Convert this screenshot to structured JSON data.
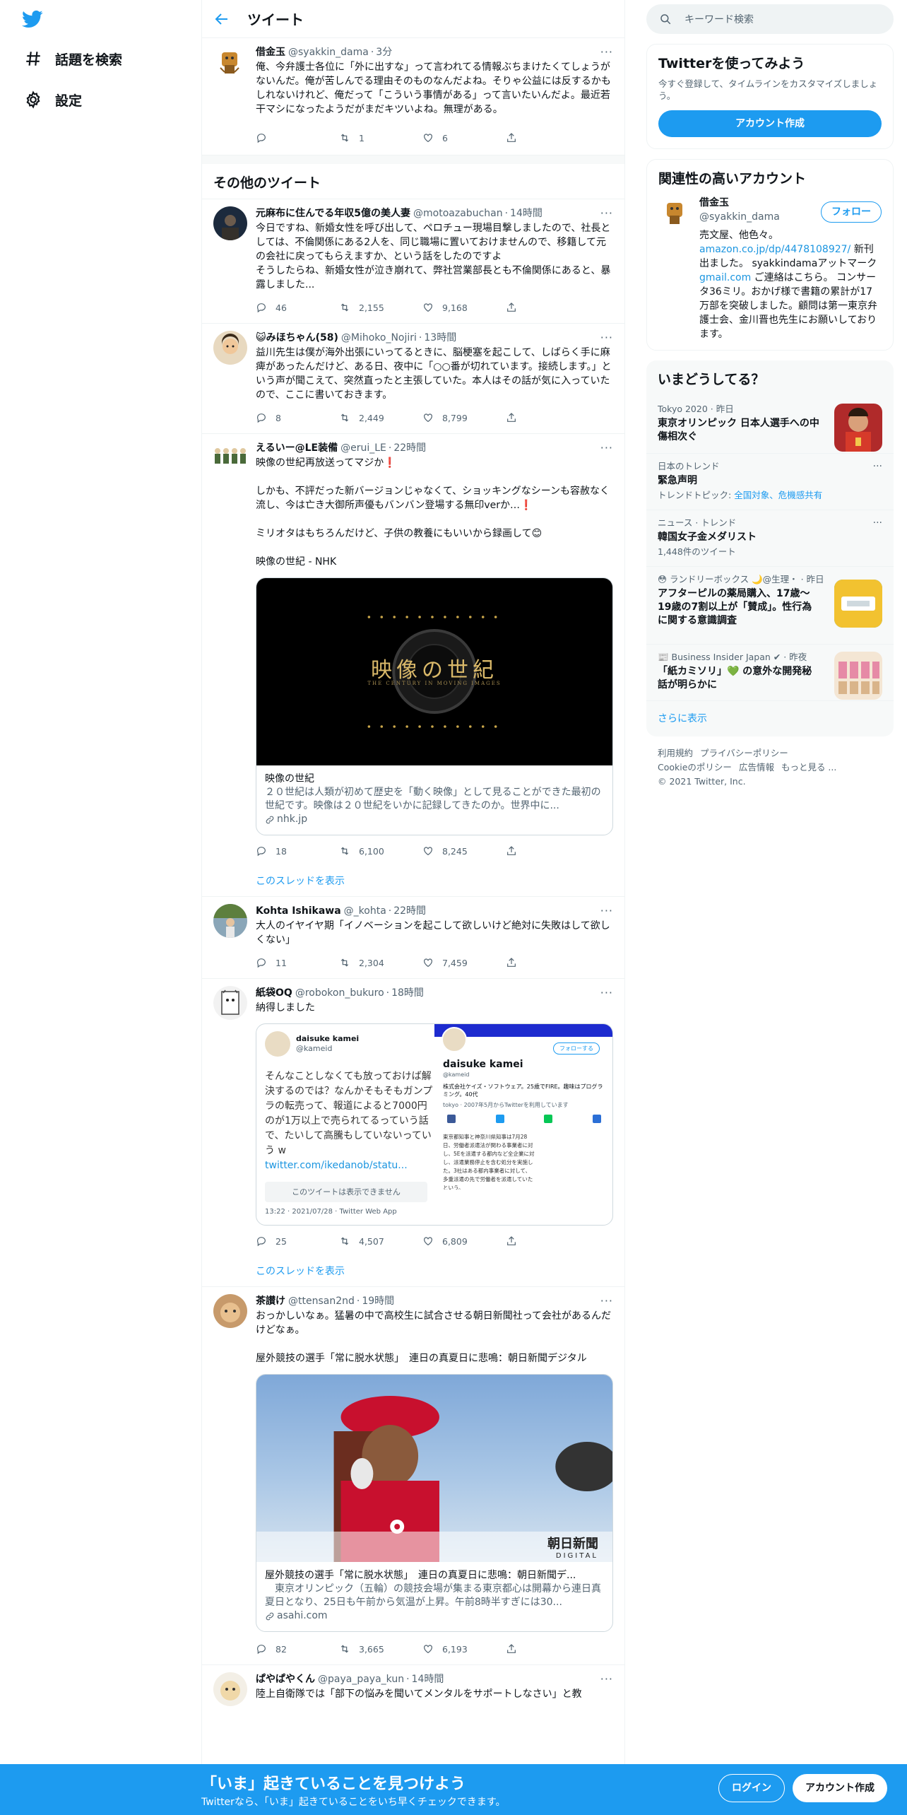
{
  "nav": {
    "explore": "話題を検索",
    "settings": "設定"
  },
  "header": {
    "title": "ツイート"
  },
  "main_tweet": {
    "name": "借金玉",
    "handle": "@syakkin_dama",
    "time": "3分",
    "text": "俺、今弁護士各位に「外に出すな」って言われてる情報ぶちまけたくてしょうがないんだ。俺が苦しんでる理由そのものなんだよね。そりゃ公益には反するかもしれないけれど、俺だって「こういう事情がある」って言いたいんだよ。最近若干マシになったようだがまだキツいよね。無理がある。",
    "reply": "",
    "retweet": "1",
    "like": "6"
  },
  "section_title": "その他のツイート",
  "tweets": [
    {
      "name": "元麻布に住んでる年収5億の美人妻",
      "handle": "@motoazabuchan",
      "time": "14時間",
      "text": "今日ですね、新婚女性を呼び出して、ペロチュー現場目撃しましたので、社長としては、不倫関係にある2人を、同じ職場に置いておけませんので、移籍して元の会社に戻ってもらえますか、という話をしたのですよ\nそうしたらね、新婚女性が泣き崩れて、弊社営業部長とも不倫関係にあると、暴露しました...",
      "reply": "46",
      "retweet": "2,155",
      "like": "9,168"
    },
    {
      "name": "😺みほちゃん(58)",
      "handle": "@Mihoko_Nojiri",
      "time": "13時間",
      "text": "益川先生は僕が海外出張にいってるときに、脳梗塞を起こして、しばらく手に麻痺があったんだけど、ある日、夜中に「○○番が切れています。接続します。」という声が聞こえて、突然直ったと主張していた。本人はその話が気に入っていたので、ここに書いておきます。",
      "reply": "8",
      "retweet": "2,449",
      "like": "8,799"
    },
    {
      "name": "えるいー@LE装備",
      "handle": "@erui_LE",
      "time": "22時間",
      "text": "映像の世紀再放送ってマジか❗\n\nしかも、不評だった新バージョンじゃなくて、ショッキングなシーンも容赦なく流し、今は亡き大御所声優もバンバン登場する無印verか…❗\n\nミリオタはもちろんだけど、子供の教養にもいいから録画して😊\n\n映像の世紀 - NHK",
      "card": {
        "logo_title": "映像の世紀",
        "logo_sub": "THE CENTURY IN MOVING IMAGES",
        "title": "映像の世紀",
        "desc": "２０世紀は人類が初めて歴史を「動く映像」として見ることができた最初の世紀です。映像は２０世紀をいかに記録してきたのか。世界中に...",
        "url": "nhk.jp"
      },
      "reply": "18",
      "retweet": "6,100",
      "like": "8,245",
      "thread": "このスレッドを表示"
    },
    {
      "name": "Kohta Ishikawa",
      "handle": "@_kohta",
      "time": "22時間",
      "text": "大人のイヤイヤ期「イノベーションを起こして欲しいけど絶対に失敗はして欲しくない」",
      "reply": "11",
      "retweet": "2,304",
      "like": "7,459"
    },
    {
      "name": "紙袋OQ",
      "handle": "@robokon_bukuro",
      "time": "18時間",
      "text": "納得しました",
      "quote": {
        "name": "daisuke kamei",
        "handle": "@kameid",
        "text": "そんなことしなくても放っておけば解決するのでは？なんかそもそもガンプラの転売って、報道によると7000円のが1万以上で売られてるっていう話で、たいして高騰もしていないってい う w ",
        "link": "twitter.com/ikedanob/statu...",
        "notice": "このツイートは表示できません",
        "footer": "13:22 · 2021/07/28 · Twitter Web App",
        "profile_name": "daisuke kamei",
        "profile_handle": "@kameid",
        "profile_follow": "フォローする",
        "profile_bio": "株式会社ケイズ・ソフトウェア。25歳でFIRE。趣味はプログラミング。40代",
        "profile_loc": "tokyo",
        "profile_joined": "2007年5月からTwitterを利用しています",
        "profile_article": "東京都知事と神奈川県知事は7月28日、労働者派遣法が関わる事業者に対し、5Eを派遣する都内など全企業に対し、派遣業務停止を含む処分を実施した。3社はある都内事業者に対して、多重派遣の先で労働者を派遣していたという。"
      },
      "reply": "25",
      "retweet": "4,507",
      "like": "6,809",
      "thread": "このスレッドを表示"
    },
    {
      "name": "茶讃け",
      "handle": "@ttensan2nd",
      "time": "19時間",
      "text": "おっかしいなぁ。猛暑の中で高校生に試合させる朝日新聞社って会社があるんだけどなぁ。\n\n屋外競技の選手「常に脱水状態」　連日の真夏日に悲鳴：朝日新聞デジタル",
      "card": {
        "overlay1": "朝日新聞",
        "overlay2": "DIGITAL",
        "title": "屋外競技の選手「常に脱水状態」　連日の真夏日に悲鳴：朝日新聞デ...",
        "desc": "　東京オリンピック（五輪）の競技会場が集まる東京都心は開幕から連日真夏日となり、25日も午前から気温が上昇。午前8時半すぎには30...",
        "url": "asahi.com"
      },
      "reply": "82",
      "retweet": "3,665",
      "like": "6,193"
    },
    {
      "name": "ぱやぱやくん",
      "handle": "@paya_paya_kun",
      "time": "14時間",
      "text": "陸上自衛隊では「部下の悩みを聞いてメンタルをサポートしなさい」と教"
    }
  ],
  "search": {
    "placeholder": "キーワード検索"
  },
  "signup_box": {
    "title": "Twitterを使ってみよう",
    "sub": "今すぐ登録して、タイムラインをカスタマイズしましょう。",
    "button": "アカウント作成"
  },
  "related": {
    "title": "関連性の高いアカウント",
    "name": "借金玉",
    "handle": "@syakkin_dama",
    "follow": "フォロー",
    "bio_1": "売文屋、他色々。",
    "bio_link1": "amazon.co.jp/dp/4478108927/",
    "bio_2": " 新刊出ました。 syakkindamaアットマーク",
    "bio_link2": "gmail.com",
    "bio_3": " ご連絡はこちら。 コンサータ36ミリ。おかげ様で書籍の累計が17万部を突破しました。顧問は第一東京弁護士会、金川晋也先生にお願いしております。"
  },
  "trends": {
    "title": "いまどうしてる？",
    "items": [
      {
        "meta": "Tokyo 2020 · 昨日",
        "title": "東京オリンピック 日本人選手への中傷相次ぐ",
        "sub": ""
      },
      {
        "meta": "日本のトレンド",
        "title": "緊急声明",
        "sub": "トレンドトピック: ",
        "links": "全国対象、危機感共有"
      },
      {
        "meta": "ニュース · トレンド",
        "title": "韓国女子金メダリスト",
        "sub": "1,448件のツイート"
      },
      {
        "meta": "😳 ランドリーボックス 🌙@生理・ · 昨日",
        "title": "アフターピルの薬局購入、17歳〜19歳の7割以上が「賛成」。性行為に関する意識調査",
        "sub": ""
      },
      {
        "meta": "📰 Business Insider Japan ✔ · 昨夜",
        "title": "「紙カミソリ」💚 の意外な開発秘話が明らかに",
        "sub": ""
      }
    ],
    "show_more": "さらに表示"
  },
  "footer": {
    "links": [
      "利用規約",
      "プライバシーポリシー",
      "Cookieのポリシー",
      "広告情報",
      "もっと見る ..."
    ],
    "copyright": "© 2021 Twitter, Inc."
  },
  "bottom": {
    "title": "「いま」起きていることを見つけよう",
    "sub": "Twitterなら、「いま」起きていることをいち早くチェックできます。",
    "login": "ログイン",
    "signup": "アカウント作成"
  },
  "colors": {
    "accent": "#1d9bf0",
    "text": "#0f1419",
    "secondary": "#536471"
  }
}
